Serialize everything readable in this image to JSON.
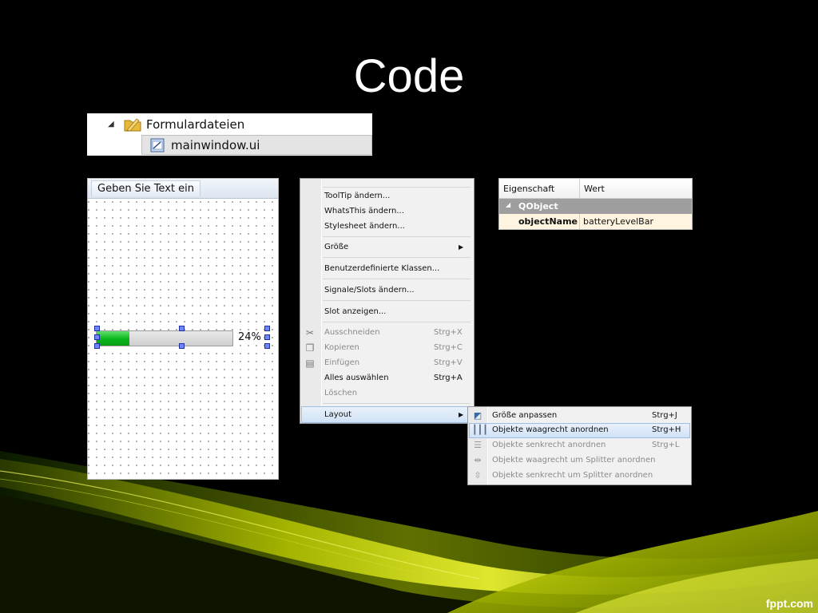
{
  "slide": {
    "title": "Code",
    "footer": "fppt.com"
  },
  "tree": {
    "folder_label": "Formulardateien",
    "file_label": "mainwindow.ui"
  },
  "form": {
    "header_text": "Geben Sie Text ein",
    "progress_value": 24,
    "progress_text": "24%"
  },
  "context_menu": {
    "items": [
      {
        "label": "ToolTip ändern..."
      },
      {
        "label": "WhatsThis ändern..."
      },
      {
        "label": "Stylesheet ändern..."
      },
      {
        "label": "Größe"
      },
      {
        "label": "Benutzerdefinierte Klassen..."
      },
      {
        "label": "Signale/Slots ändern..."
      },
      {
        "label": "Slot anzeigen..."
      },
      {
        "label": "Ausschneiden",
        "shortcut": "Strg+X"
      },
      {
        "label": "Kopieren",
        "shortcut": "Strg+C"
      },
      {
        "label": "Einfügen",
        "shortcut": "Strg+V"
      },
      {
        "label": "Alles auswählen",
        "shortcut": "Strg+A"
      },
      {
        "label": "Löschen"
      },
      {
        "label": "Layout"
      }
    ]
  },
  "layout_submenu": {
    "items": [
      {
        "label": "Größe anpassen",
        "shortcut": "Strg+J"
      },
      {
        "label": "Objekte waagrecht anordnen",
        "shortcut": "Strg+H"
      },
      {
        "label": "Objekte senkrecht anordnen",
        "shortcut": "Strg+L"
      },
      {
        "label": "Objekte waagrecht um Splitter anordnen"
      },
      {
        "label": "Objekte senkrecht um Splitter anordnen"
      }
    ]
  },
  "property_editor": {
    "col_property": "Eigenschaft",
    "col_value": "Wert",
    "group": "QObject",
    "prop_name": "objectName",
    "prop_value": "batteryLevelBar"
  },
  "colors": {
    "accent_green": "#08b51c",
    "swoosh_yellow": "#c8d400",
    "background": "#000000"
  }
}
